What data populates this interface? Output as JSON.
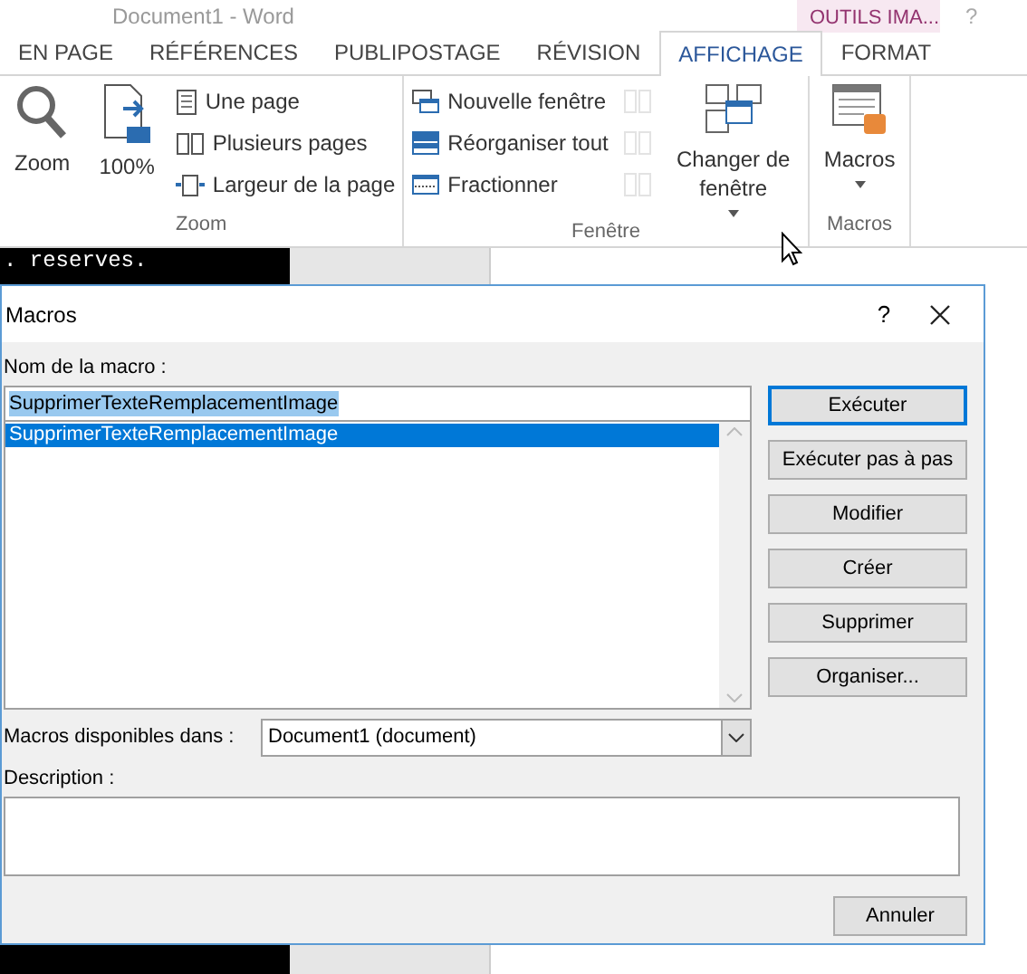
{
  "window": {
    "title": "Document1 - Word",
    "contextual_tab": "OUTILS IMA...",
    "help": "?"
  },
  "tabs": [
    {
      "label": "EN PAGE",
      "selected": false
    },
    {
      "label": "RÉFÉRENCES",
      "selected": false
    },
    {
      "label": "PUBLIPOSTAGE",
      "selected": false
    },
    {
      "label": "RÉVISION",
      "selected": false
    },
    {
      "label": "AFFICHAGE",
      "selected": true
    },
    {
      "label": "FORMAT",
      "selected": false
    }
  ],
  "ribbon": [
    {
      "label": "Zoom",
      "items": [
        {
          "kind": "large",
          "label": "Zoom"
        },
        {
          "kind": "large",
          "label": "100%"
        },
        {
          "kind": "small",
          "label": "Une page"
        },
        {
          "kind": "small",
          "label": "Plusieurs pages"
        },
        {
          "kind": "small",
          "label": "Largeur de la page"
        }
      ]
    },
    {
      "label": "Fenêtre",
      "items": [
        {
          "kind": "small",
          "label": "Nouvelle fenêtre"
        },
        {
          "kind": "small",
          "label": "Réorganiser tout"
        },
        {
          "kind": "small",
          "label": "Fractionner"
        },
        {
          "kind": "icon",
          "disabled": true
        },
        {
          "kind": "icon",
          "disabled": true
        },
        {
          "kind": "icon",
          "disabled": true
        },
        {
          "kind": "large",
          "label": "Changer de fenêtre",
          "dropdown": true
        }
      ]
    },
    {
      "label": "Macros",
      "items": [
        {
          "kind": "large",
          "label": "Macros",
          "dropdown": true
        }
      ]
    }
  ],
  "document": {
    "code_text": ". reserves."
  },
  "dialog": {
    "title": "Macros",
    "help": "?",
    "name_label": "Nom de la macro :",
    "name_value": "SupprimerTexteRemplacementImage",
    "macros": [
      {
        "label": "SupprimerTexteRemplacementImage",
        "selected": true
      }
    ],
    "buttons": [
      {
        "label": "Exécuter",
        "default": true
      },
      {
        "label": "Exécuter pas à pas",
        "default": false
      },
      {
        "label": "Modifier",
        "default": false
      },
      {
        "label": "Créer",
        "default": false
      },
      {
        "label": "Supprimer",
        "default": false
      },
      {
        "label": "Organiser...",
        "default": false
      }
    ],
    "source_label": "Macros disponibles dans :",
    "source_value": "Document1 (document)",
    "description_label": "Description :",
    "cancel": "Annuler"
  }
}
